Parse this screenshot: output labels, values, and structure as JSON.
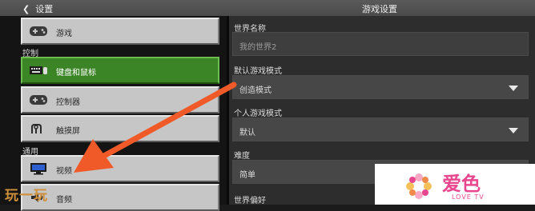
{
  "header": {
    "back_label": "设置",
    "title": "游戏设置"
  },
  "sidebar": {
    "items": [
      {
        "label": "游戏",
        "icon": "gamepad-icon"
      },
      {
        "label": "键盘和鼠标",
        "icon": "keyboard-icon",
        "selected": true
      },
      {
        "label": "控制器",
        "icon": "gamepad-icon"
      },
      {
        "label": "触摸屏",
        "icon": "touch-icon"
      },
      {
        "label": "视频",
        "icon": "monitor-icon"
      },
      {
        "label": "音频",
        "icon": "speaker-icon"
      }
    ],
    "sections": {
      "controls": "控制",
      "general": "通用"
    }
  },
  "settings": {
    "world_name": {
      "label": "世界名称",
      "value": "我的世界2"
    },
    "default_mode": {
      "label": "默认游戏模式",
      "value": "创造模式"
    },
    "personal_mode": {
      "label": "个人游戏模式",
      "value": "默认"
    },
    "difficulty": {
      "label": "难度",
      "value": "简单"
    },
    "world_prefs": {
      "label": "世界偏好"
    }
  },
  "watermarks": {
    "left": "玩一玩",
    "right_big": "爱色",
    "right_small": "LOVE TV"
  },
  "colors": {
    "selected_green": "#3c8527",
    "arrow_red": "#f05a28",
    "watermark_pink": "#e8478f"
  }
}
